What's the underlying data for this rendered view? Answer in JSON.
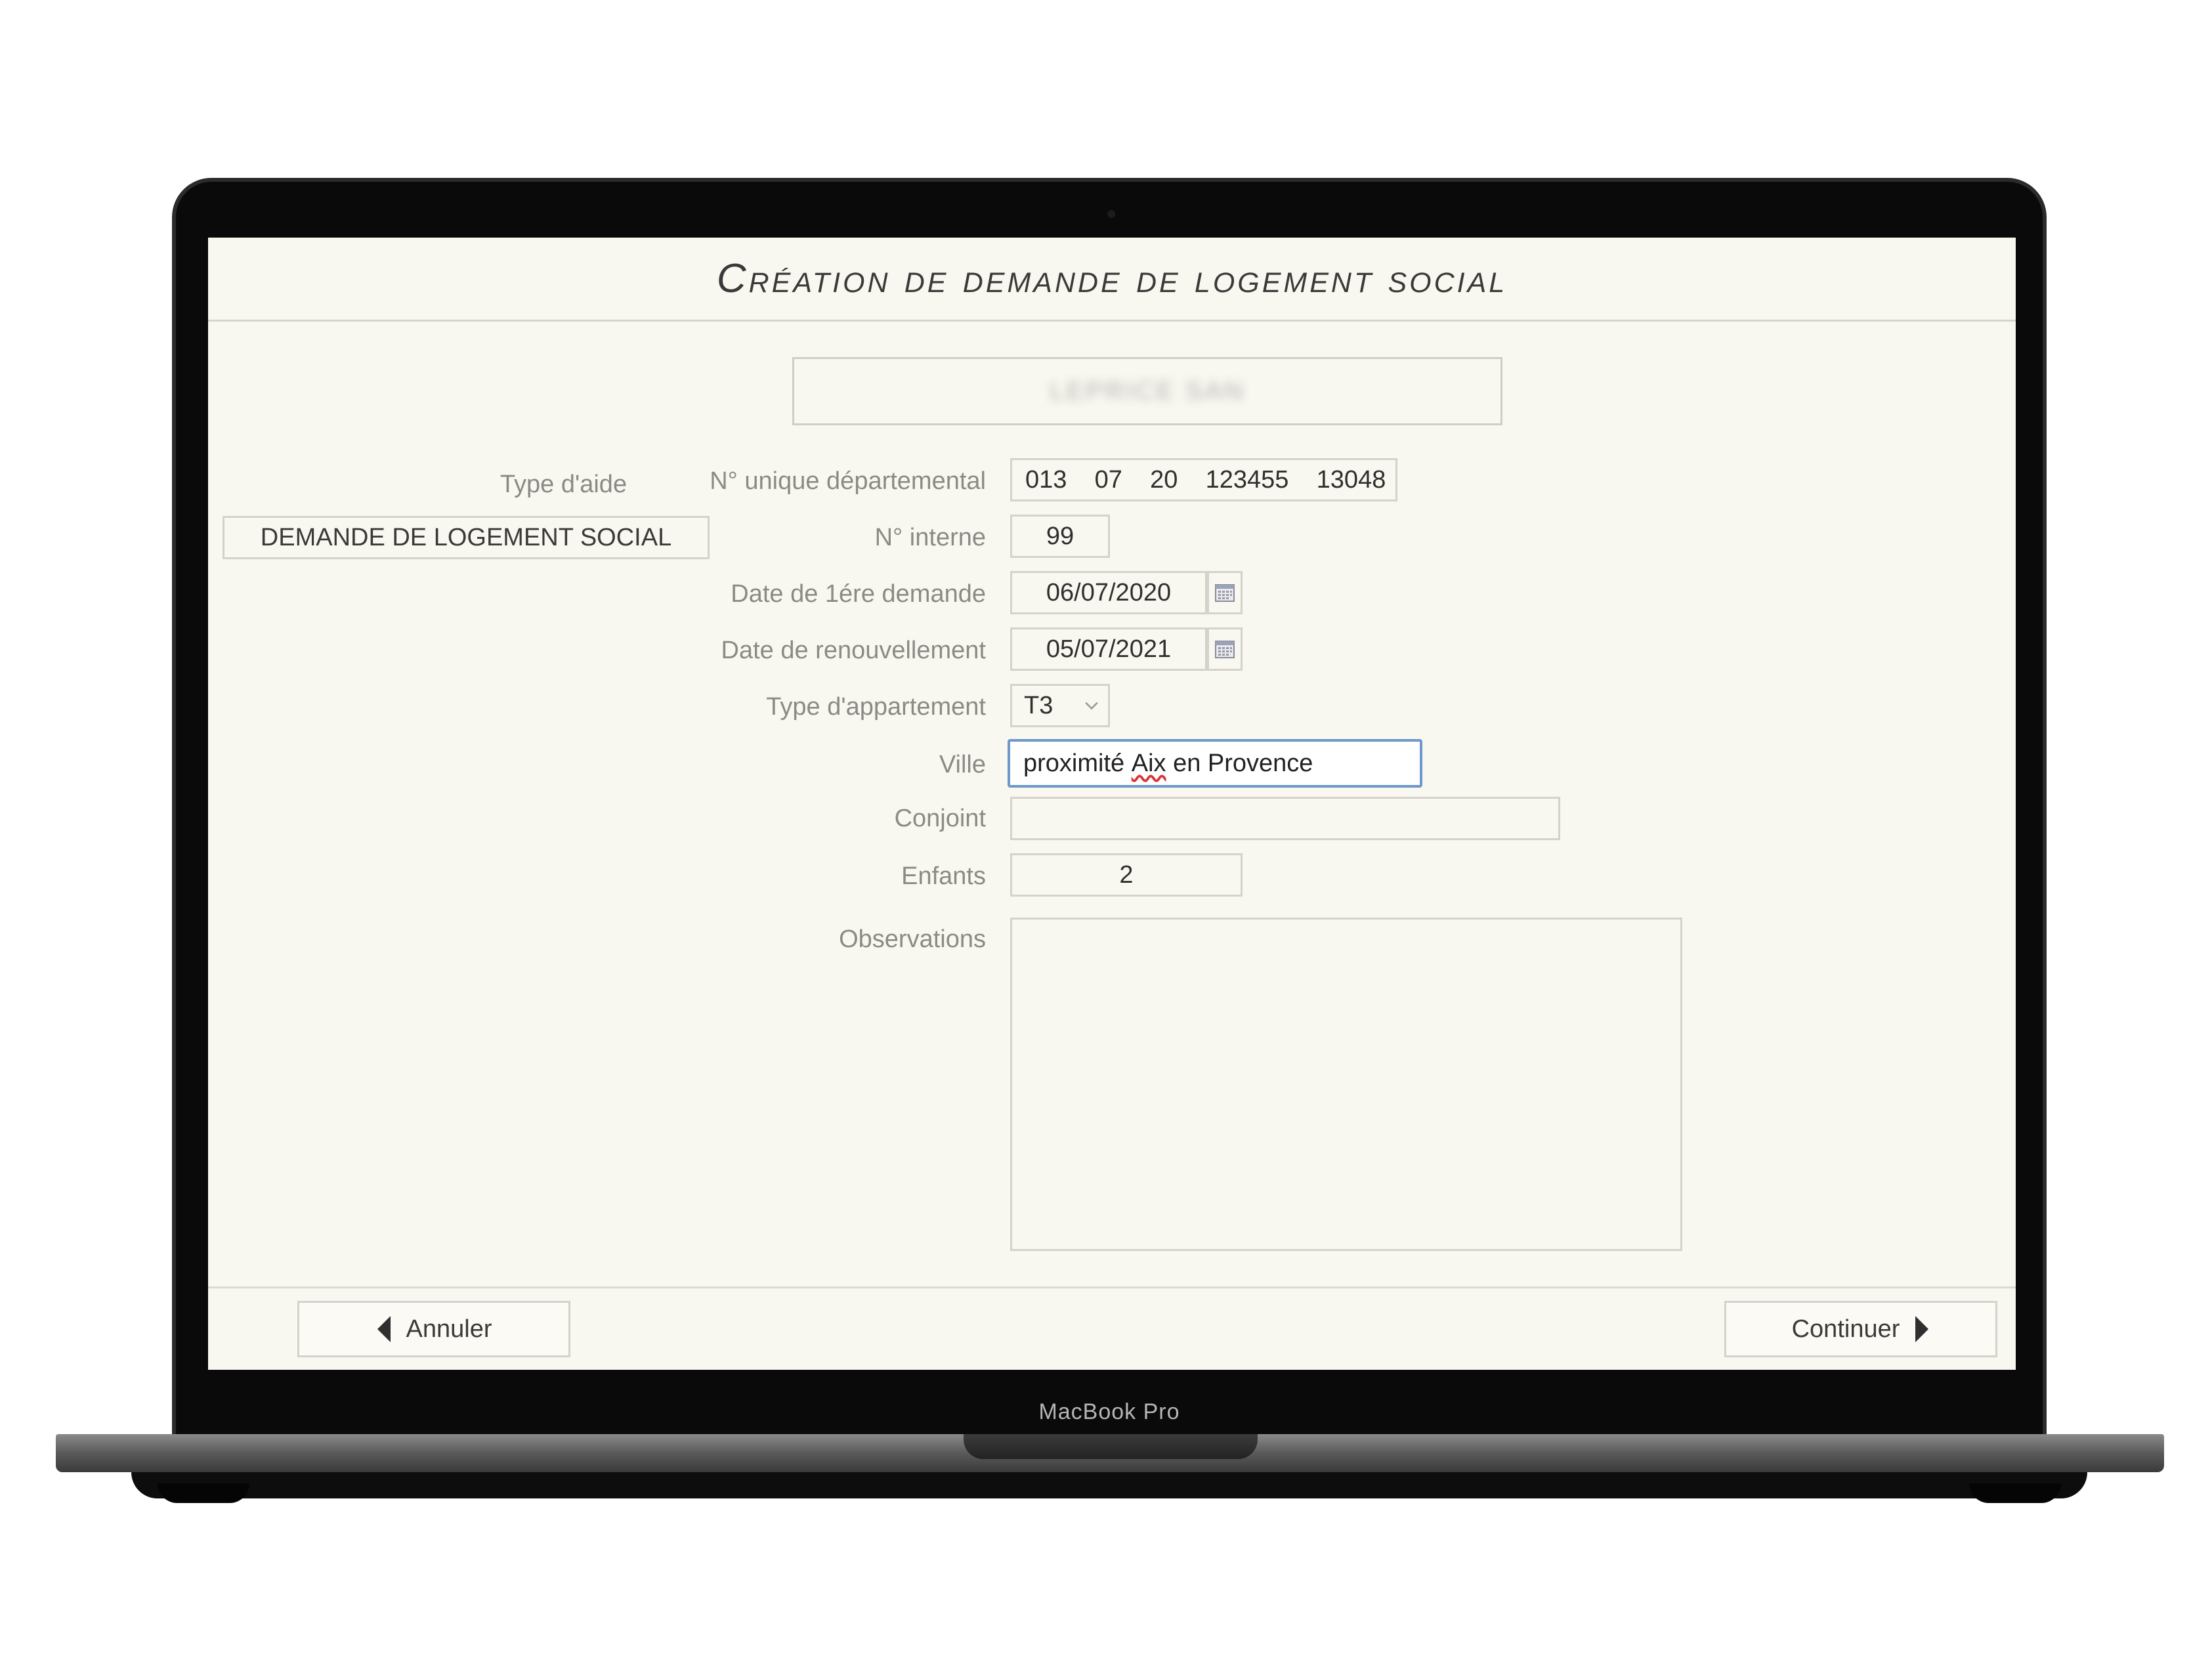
{
  "app": {
    "title": "Création de demande de logement social",
    "user_name": "LEPRICE SAN"
  },
  "left": {
    "type_aide_label": "Type d'aide",
    "type_aide_value": "DEMANDE DE LOGEMENT SOCIAL"
  },
  "form": {
    "numero_unique_label": "N° unique départemental",
    "numero_unique_value": "013    07    20    123455    13048",
    "numero_interne_label": "N° interne",
    "numero_interne_value": "99",
    "date_premiere_label": "Date de 1ére demande",
    "date_premiere_value": "06/07/2020",
    "date_renouvellement_label": "Date de renouvellement",
    "date_renouvellement_value": "05/07/2021",
    "type_appartement_label": "Type d'appartement",
    "type_appartement_value": "T3",
    "ville_label": "Ville",
    "ville_value_pre": "proximité ",
    "ville_value_aix": "Aix",
    "ville_value_post": " en Provence",
    "conjoint_label": "Conjoint",
    "conjoint_value": "",
    "enfants_label": "Enfants",
    "enfants_value": "2",
    "observations_label": "Observations",
    "observations_value": ""
  },
  "buttons": {
    "cancel_label": "Annuler",
    "continue_label": "Continuer"
  },
  "device": {
    "label": "MacBook Pro"
  },
  "icons": {
    "calendar": "calendar-icon",
    "chevron": "chevron-down-icon",
    "arrow_left": "arrow-left-icon",
    "arrow_right": "arrow-right-icon"
  },
  "colors": {
    "screen_bg": "#f9f8f0",
    "focus_border": "#6e98c9",
    "label_text": "#8c8a86"
  }
}
